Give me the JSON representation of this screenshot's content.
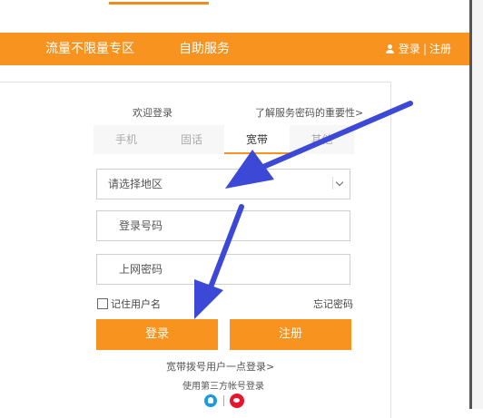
{
  "nav": {
    "zone_label": "流量不限量专区",
    "self_service_label": "自助服务",
    "login_label": "登录",
    "separator": "|",
    "register_label": "注册"
  },
  "login": {
    "welcome": "欢迎登录",
    "why_link": "了解服务密码的重要性>",
    "tabs": [
      {
        "label": "手机",
        "active": false
      },
      {
        "label": "固话",
        "active": false
      },
      {
        "label": "宽带",
        "active": true
      },
      {
        "label": "其他",
        "active": false
      }
    ],
    "region_value": "请选择地区",
    "account_placeholder": "登录号码",
    "password_placeholder": "上网密码",
    "remember_label": "记住用户名",
    "forgot_label": "忘记密码",
    "login_button": "登录",
    "register_button": "注册",
    "quick_login": "宽带拨号用户一点登录>",
    "third_party": "使用第三方帐号登录"
  },
  "colors": {
    "brand_orange": "#f7931e",
    "annotation_arrow": "#3b49d6"
  },
  "icons": {
    "user": "user-icon",
    "dropdown": "chevron-down-icon",
    "qq": "qq-icon",
    "weibo": "weibo-icon"
  }
}
